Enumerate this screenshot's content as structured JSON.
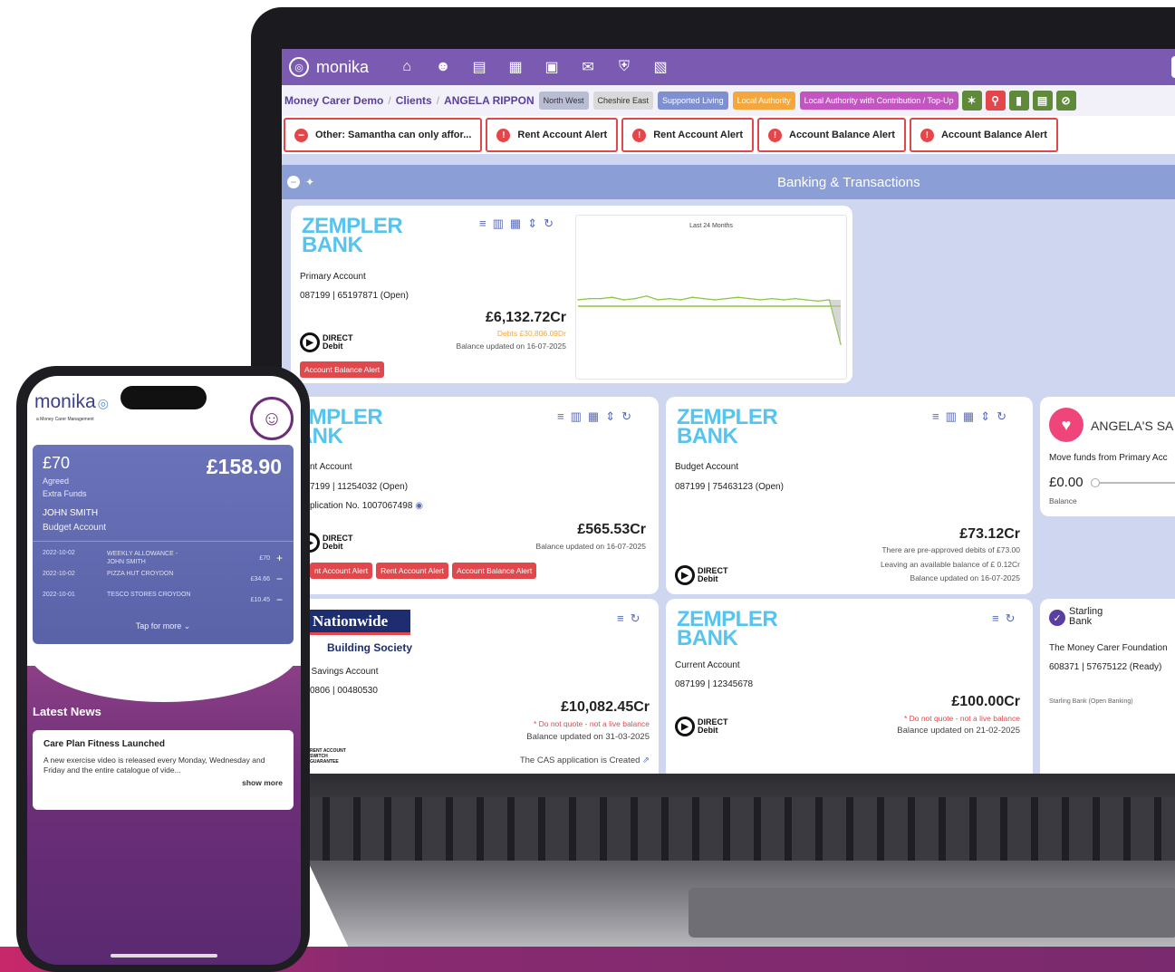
{
  "laptop": {
    "app_name": "monika",
    "nav_icons": [
      "home-icon",
      "people-icon",
      "id-card-icon",
      "receipt-icon",
      "clipboard-icon",
      "mail-icon",
      "shield-icon",
      "calendar-gift-icon"
    ],
    "breadcrumb": [
      "Money Carer Demo",
      "Clients",
      "ANGELA RIPPON"
    ],
    "tags": [
      {
        "label": "North West",
        "color": "#b9bdd3",
        "text": "#333333"
      },
      {
        "label": "Cheshire East",
        "color": "#d9d9d9",
        "text": "#333333"
      },
      {
        "label": "Supported Living",
        "color": "#7e90d0",
        "text": "#ffffff"
      },
      {
        "label": "Local Authority",
        "color": "#f3a73c",
        "text": "#ffffff"
      },
      {
        "label": "Local Authority with Contribution / Top-Up",
        "color": "#c355c0",
        "text": "#ffffff"
      }
    ],
    "alerts": [
      "Other: Samantha can only affor...",
      "Rent Account Alert",
      "Rent Account Alert",
      "Account Balance Alert",
      "Account Balance Alert"
    ],
    "section_title": "Banking & Transactions",
    "cards": {
      "primary": {
        "bank": "ZEMPLER BANK",
        "account": "Primary Account",
        "number": "087199 | 65197871 (Open)",
        "balance": "£6,132.72Cr",
        "debts": "Debts £30,806.09Dr",
        "updated": "Balance updated on 16-07-2025",
        "badge": "Account Balance Alert",
        "chart_title": "Last 24 Months"
      },
      "second": {
        "bank": "ZEMPLER BANK",
        "account": "nt Account",
        "number": "7199 | 11254032 (Open)",
        "application": "plication No. 1007067498",
        "balance": "£565.53Cr",
        "updated": "Balance updated on 16-07-2025",
        "badges": [
          "nt Account Alert",
          "Rent Account Alert",
          "Account Balance Alert"
        ]
      },
      "budget": {
        "bank": "ZEMPLER BANK",
        "account": "Budget Account",
        "number": "087199 | 75463123 (Open)",
        "balance": "£73.12Cr",
        "note1": "There are pre-approved debits of £73.00",
        "note2": "Leaving an available balance of £ 0.12Cr",
        "updated": "Balance updated on 16-07-2025"
      },
      "savings": {
        "title": "ANGELA'S SA",
        "move": "Move funds from Primary Acc",
        "balance": "£0.00",
        "label": "Balance"
      },
      "nationwide": {
        "bank": "Nationwide",
        "sub": "Building Society",
        "account": "\\ Savings Account",
        "number": "0806 | 00480530",
        "balance": "£10,082.45Cr",
        "warn": "* Do not quote - not a live balance",
        "updated": "Balance updated on 31-03-2025",
        "cas": "The CAS application is Created",
        "stamp": "RENT ACCOUNT\nSWITCH\nGUARANTEE"
      },
      "current": {
        "bank": "ZEMPLER BANK",
        "account": "Current Account",
        "number": "087199 | 12345678",
        "balance": "£100.00Cr",
        "warn": "* Do not quote - not a live balance",
        "updated": "Balance updated on 21-02-2025"
      },
      "starling": {
        "bank": "Starling Bank",
        "org": "The Money Carer Foundation",
        "number": "608371 | 57675122 (Ready)",
        "source": "Starling Bank (Open Banking)"
      }
    },
    "direct_debit": "DIRECT Debit"
  },
  "phone": {
    "logo": "monika",
    "logo_sub": "a Money Carer Management",
    "agreed_amount": "£70",
    "agreed_label": "Agreed",
    "extra_label": "Extra Funds",
    "balance": "£158.90",
    "name": "JOHN SMITH",
    "account": "Budget Account",
    "transactions": [
      {
        "date": "2022-10-02",
        "desc": "WEEKLY ALLOWANCE -\nJOHN SMITH",
        "amount": "£70",
        "sign": "+"
      },
      {
        "date": "2022-10-02",
        "desc": "PIZZA HUT CROYDON",
        "amount": "£34.66",
        "sign": "−"
      },
      {
        "date": "2022-10-01",
        "desc": "TESCO STORES CROYDON",
        "amount": "£10.45",
        "sign": "−"
      }
    ],
    "tap_more": "Tap for more",
    "news_heading": "Latest News",
    "news": {
      "title": "Care Plan Fitness Launched",
      "body": "A new exercise video is released every Monday, Wednesday and Friday and the entire catalogue of vide...",
      "link": "show more"
    }
  },
  "chart_data": {
    "type": "line",
    "title": "Last 24 Months",
    "series": [
      {
        "values": [
          0.55,
          0.56,
          0.56,
          0.57,
          0.55,
          0.56,
          0.58,
          0.55,
          0.56,
          0.55,
          0.57,
          0.56,
          0.55,
          0.56,
          0.57,
          0.56,
          0.55,
          0.56,
          0.55,
          0.56,
          0.55,
          0.54,
          0.55,
          0.2
        ]
      }
    ],
    "reference_level": 0.5,
    "grid": false
  }
}
